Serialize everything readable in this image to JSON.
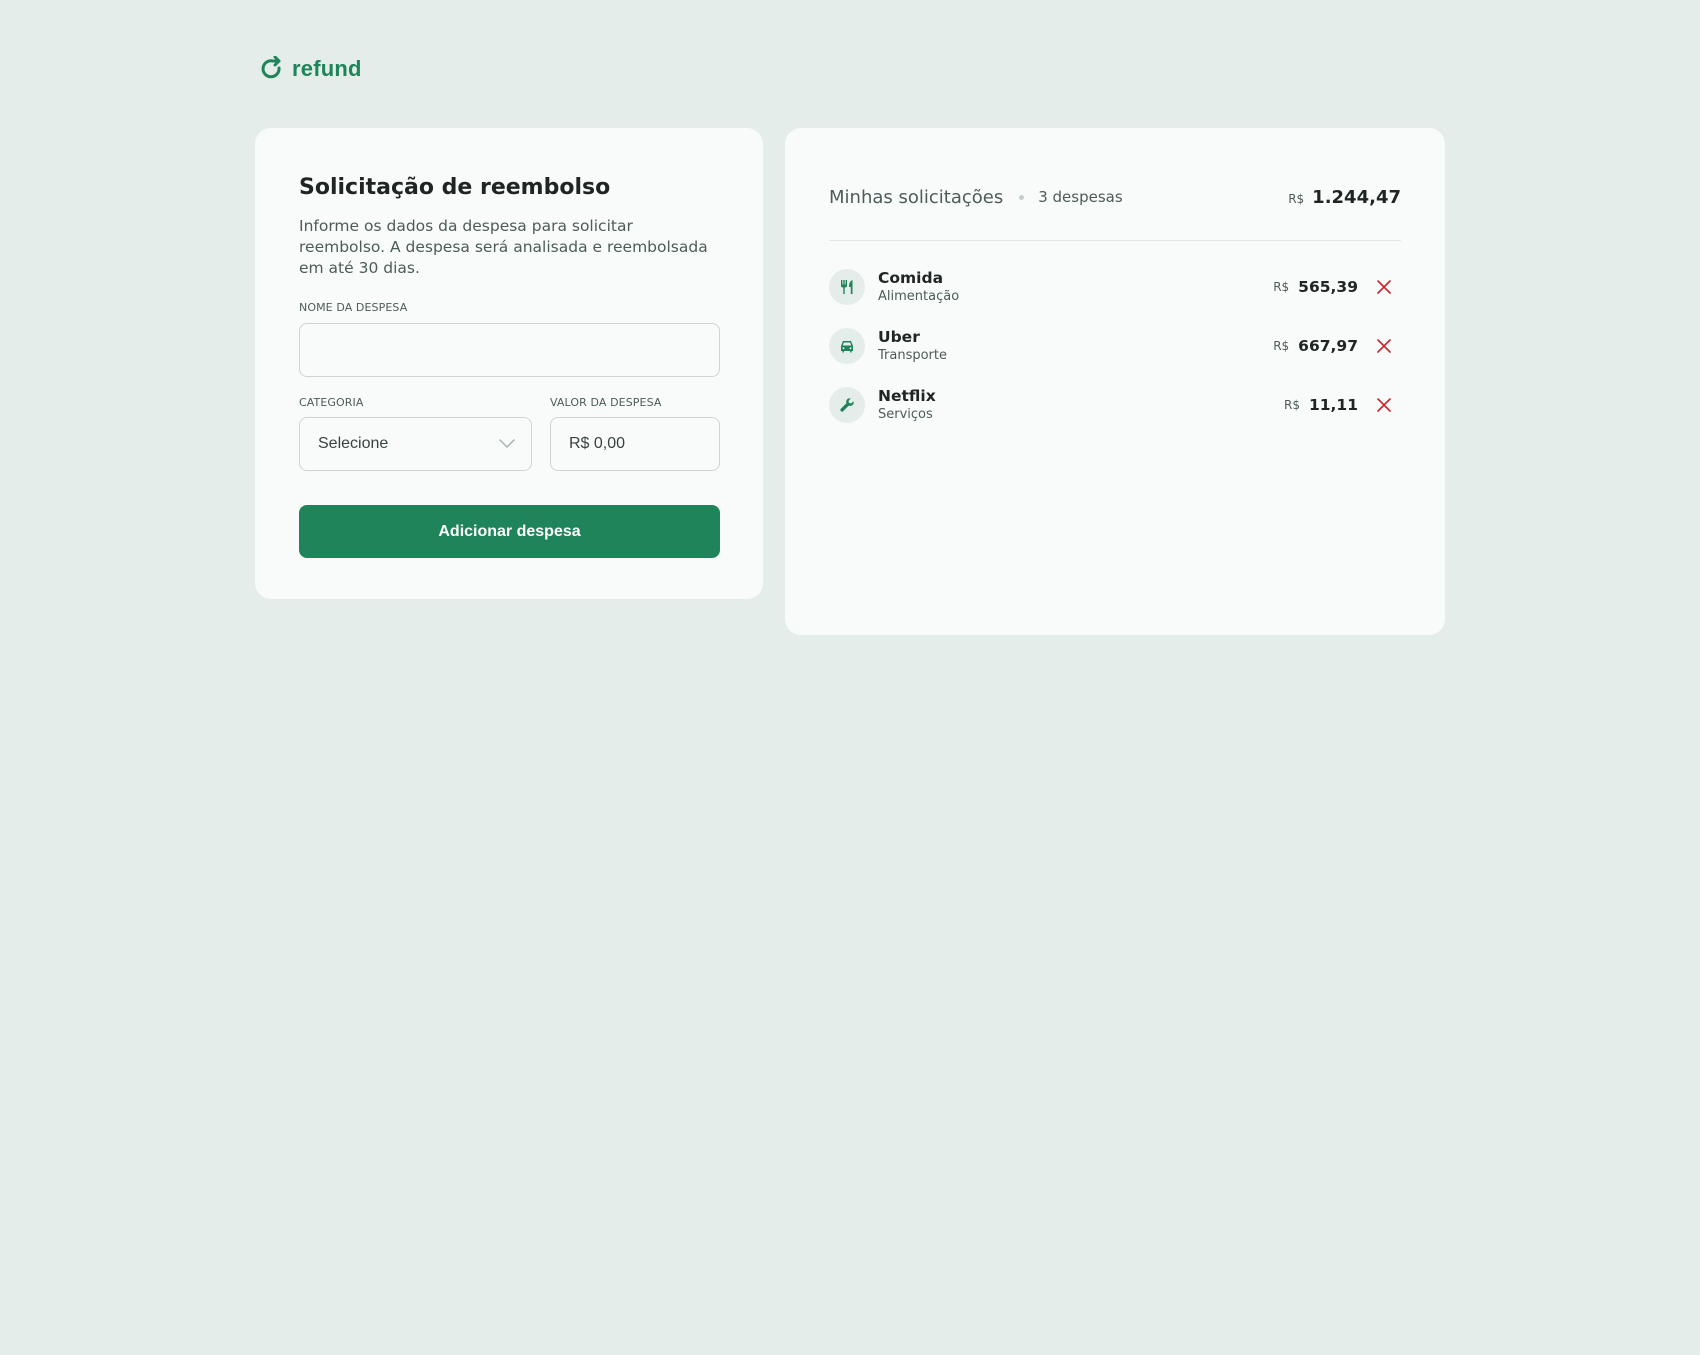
{
  "brand": {
    "name": "refund",
    "color": "#1f8459"
  },
  "form": {
    "title": "Solicitação de reembolso",
    "description": "Informe os dados da despesa para solicitar reembolso. A despesa será analisada e reembolsada em até 30 dias.",
    "name_label": "NOME DA DESPESA",
    "name_value": "",
    "category_label": "CATEGORIA",
    "category_value": "Selecione",
    "amount_label": "VALOR DA DESPESA",
    "amount_placeholder": "R$ 0,00",
    "submit_label": "Adicionar despesa"
  },
  "requests": {
    "title": "Minhas solicitações",
    "count": "3 despesas",
    "total_currency": "R$",
    "total_value": "1.244,47",
    "items": [
      {
        "name": "Comida",
        "category": "Alimentação",
        "icon": "fork-knife-icon",
        "currency": "R$",
        "value": "565,39"
      },
      {
        "name": "Uber",
        "category": "Transporte",
        "icon": "car-icon",
        "currency": "R$",
        "value": "667,97"
      },
      {
        "name": "Netflix",
        "category": "Serviços",
        "icon": "wrench-icon",
        "currency": "R$",
        "value": "11,11"
      }
    ]
  },
  "colors": {
    "accent": "#1f8459",
    "danger": "#c8272e",
    "background": "#e4ede9"
  }
}
